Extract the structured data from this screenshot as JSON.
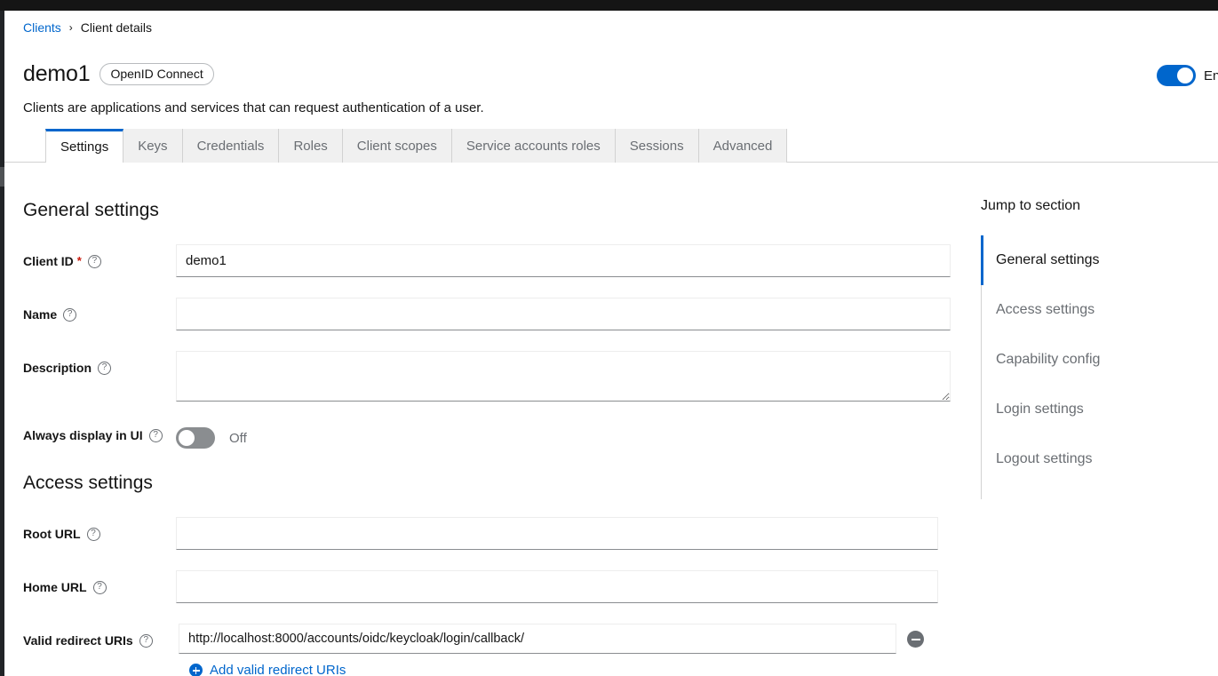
{
  "window": {
    "enabled_toggle_label": "Enabled"
  },
  "breadcrumb": {
    "parent": "Clients",
    "separator": "›",
    "current": "Client details"
  },
  "header": {
    "title": "demo1",
    "badge": "OpenID Connect",
    "subtitle": "Clients are applications and services that can request authentication of a user.",
    "enabled": true
  },
  "tabs": [
    {
      "label": "Settings",
      "active": true
    },
    {
      "label": "Keys",
      "active": false
    },
    {
      "label": "Credentials",
      "active": false
    },
    {
      "label": "Roles",
      "active": false
    },
    {
      "label": "Client scopes",
      "active": false
    },
    {
      "label": "Service accounts roles",
      "active": false
    },
    {
      "label": "Sessions",
      "active": false
    },
    {
      "label": "Advanced",
      "active": false
    }
  ],
  "general_settings": {
    "heading": "General settings",
    "client_id": {
      "label": "Client ID",
      "required_marker": "*",
      "help": "?",
      "value": "demo1",
      "placeholder": ""
    },
    "name": {
      "label": "Name",
      "help": "?",
      "value": "",
      "placeholder": ""
    },
    "description": {
      "label": "Description",
      "help": "?",
      "value": "",
      "placeholder": ""
    },
    "always_display": {
      "label": "Always display in UI",
      "help": "?",
      "state_label": "Off",
      "on": false
    }
  },
  "access_settings": {
    "heading": "Access settings",
    "root_url": {
      "label": "Root URL",
      "help": "?",
      "value": "",
      "placeholder": ""
    },
    "home_url": {
      "label": "Home URL",
      "help": "?",
      "value": "",
      "placeholder": ""
    },
    "valid_redirect_uris": {
      "label": "Valid redirect URIs",
      "help": "?",
      "value": "http://localhost:8000/accounts/oidc/keycloak/login/callback/",
      "placeholder": "",
      "add_label": "Add valid redirect URIs",
      "remove_icon": "minus-circle-icon"
    }
  },
  "jump_to_section": {
    "title": "Jump to section",
    "items": [
      {
        "label": "General settings",
        "active": true
      },
      {
        "label": "Access settings",
        "active": false
      },
      {
        "label": "Capability config",
        "active": false
      },
      {
        "label": "Login settings",
        "active": false
      },
      {
        "label": "Logout settings",
        "active": false
      }
    ]
  },
  "colors": {
    "accent": "#0066cc",
    "required": "#c9190b",
    "muted": "#6a6e73",
    "border": "#d2d2d2",
    "dark": "#151515"
  }
}
